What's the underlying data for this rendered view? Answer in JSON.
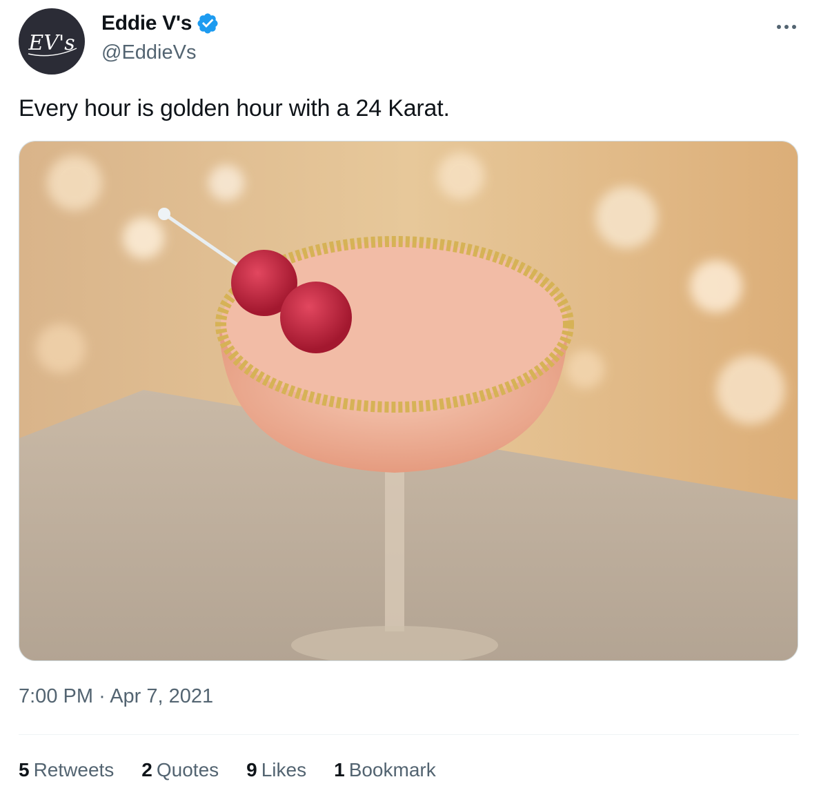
{
  "author": {
    "display_name": "Eddie V's",
    "handle": "@EddieVs",
    "avatar_text": "EV's",
    "avatar_bg": "#2b2c36",
    "verified_icon": "verified-badge-icon",
    "verified_color": "#1d9bf0"
  },
  "tweet": {
    "text": "Every hour is golden hour with a 24 Karat.",
    "media_description_icon": "cocktail-photo",
    "time": "7:00 PM",
    "separator": "·",
    "date": "Apr 7, 2021"
  },
  "stats": [
    {
      "count": "5",
      "label": "Retweets"
    },
    {
      "count": "2",
      "label": "Quotes"
    },
    {
      "count": "9",
      "label": "Likes"
    },
    {
      "count": "1",
      "label": "Bookmark"
    }
  ],
  "colors": {
    "text_primary": "#0f1419",
    "text_secondary": "#536471",
    "border": "#cfd9de"
  }
}
